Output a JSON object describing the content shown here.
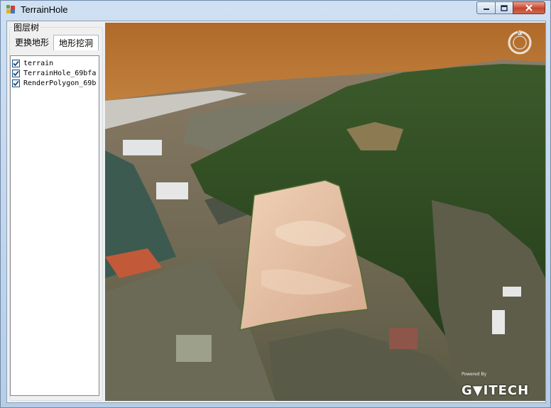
{
  "window": {
    "title": "TerrainHole"
  },
  "panel": {
    "group_title": "图层树",
    "tabs": [
      {
        "label": "更换地形"
      },
      {
        "label": "地形挖洞"
      }
    ],
    "tree_items": [
      {
        "label": "terrain",
        "checked": true
      },
      {
        "label": "TerrainHole_69bfa",
        "checked": true
      },
      {
        "label": "RenderPolygon_69b",
        "checked": true
      }
    ]
  },
  "viewport": {
    "powered_label": "Powered By",
    "logo_text": "G▼ITECH"
  }
}
